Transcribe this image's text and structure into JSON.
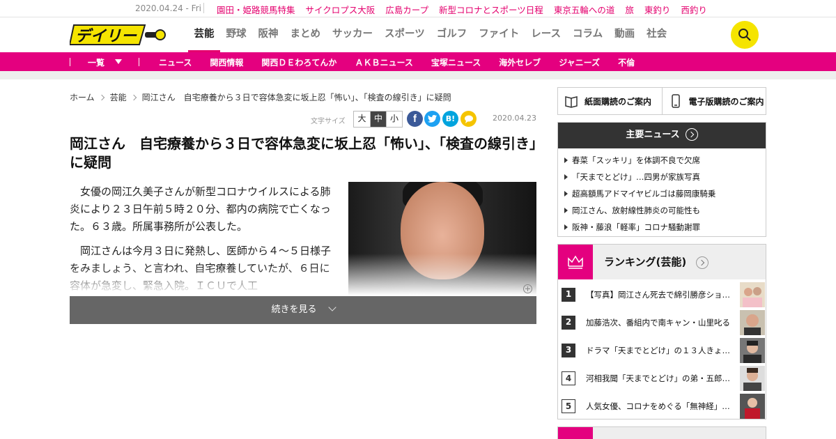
{
  "topbar": {
    "date": "2020.04.24 - Fri",
    "links": [
      "園田・姫路競馬特集",
      "サイクロプス大阪",
      "広島カープ",
      "新型コロナとスポーツ日程",
      "東京五輪への道",
      "旅",
      "東釣り",
      "西釣り"
    ]
  },
  "header": {
    "logo_text": "デイリー",
    "nav": [
      "芸能",
      "野球",
      "阪神",
      "まとめ",
      "サッカー",
      "スポーツ",
      "ゴルフ",
      "ファイト",
      "レース",
      "コラム",
      "動画",
      "社会"
    ],
    "active_nav": "芸能"
  },
  "subnav": {
    "ichiran": "一覧",
    "items": [
      "ニュース",
      "関西情報",
      "関西ＤＥわろてんか",
      "ＡＫＢニュース",
      "宝塚ニュース",
      "海外セレブ",
      "ジャニーズ",
      "不倫"
    ]
  },
  "breadcrumb": [
    "ホーム",
    "芸能",
    "岡江さん　自宅療養から３日で容体急変に坂上忍「怖い」、「検査の線引き」に疑問"
  ],
  "tools": {
    "font_size_label": "文字サイズ",
    "sizes": [
      "大",
      "中",
      "小"
    ],
    "selected_size": "中",
    "share": {
      "facebook": "f",
      "hatena": "B!"
    },
    "date": "2020.04.23"
  },
  "article": {
    "headline": "岡江さん　自宅療養から３日で容体急変に坂上忍「怖い」、「検査の線引き」に疑問",
    "paragraphs": [
      "女優の岡江久美子さんが新型コロナウイルスによる肺炎により２３日午前５時２０分、都内の病院で亡くなった。６３歳。所属事務所が公表した。",
      "岡江さんは今月３日に発熱し、医師から４～５日様子をみましょう、と言われ、自宅療養していたが、６日に容体が急変し、緊急入院。ＩＣＵで人工"
    ],
    "continue_label": "続きを見る"
  },
  "sidebar": {
    "subscribe_paper": "紙面購読のご案内",
    "subscribe_digital": "電子版購読のご案内",
    "main_news_title": "主要ニュース",
    "main_news": [
      "春菜「スッキリ」を体調不良で欠席",
      "「天までとどけ」…四男が家族写真",
      "超高額馬アドマイヤビルゴは藤岡康騎乗",
      "岡江さん、放射線性肺炎の可能性も",
      "阪神・藤浪「軽率」コロナ騒動謝罪"
    ],
    "ranking_title": "ランキング(芸能)",
    "ranking": [
      {
        "rank": "1",
        "text": "【写真】岡江さん死去で綿引勝彦ショ…"
      },
      {
        "rank": "2",
        "text": "加藤浩次、番組内で南キャン・山里叱る"
      },
      {
        "rank": "3",
        "text": "ドラマ「天までとどけ」の１３人きょ…"
      },
      {
        "rank": "4",
        "text": "河相我聞「天までとどけ」の弟・五郎…"
      },
      {
        "rank": "5",
        "text": "人気女優、コロナをめぐる「無神経」…"
      }
    ]
  },
  "colors": {
    "brand_pink": "#e4007f",
    "logo_yellow": "#f5e400",
    "dark": "#333333"
  }
}
